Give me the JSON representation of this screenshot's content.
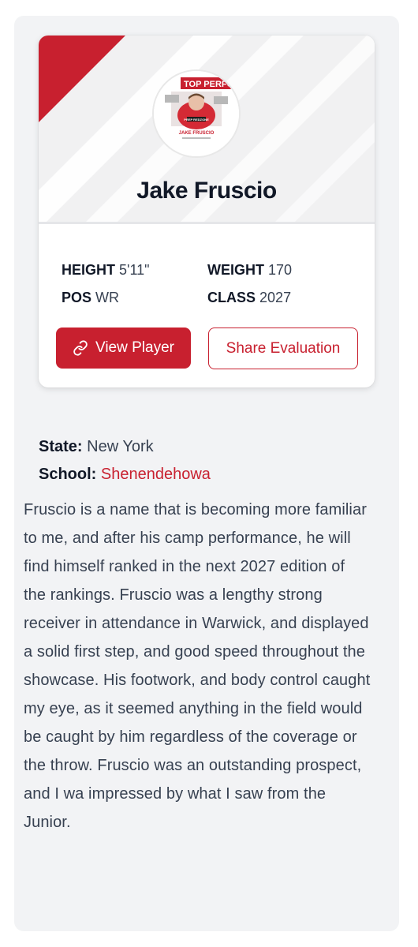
{
  "player": {
    "name": "Jake Fruscio",
    "photo_banner": "TOP PERFORMER",
    "photo_caption": "JAKE FRUSCIO",
    "photo_logo": "PREP REDZONE"
  },
  "stats": {
    "height_label": "HEIGHT",
    "height_value": "5'11\"",
    "weight_label": "WEIGHT",
    "weight_value": "170",
    "pos_label": "POS",
    "pos_value": "WR",
    "class_label": "CLASS",
    "class_value": "2027"
  },
  "actions": {
    "view_player": "View Player",
    "share_evaluation": "Share Evaluation"
  },
  "info": {
    "state_label": "State:",
    "state_value": "New York",
    "school_label": "School:",
    "school_value": "Shenendehowa"
  },
  "evaluation": {
    "text": "Fruscio is a name that is becoming more familiar to me, and after his camp performance, he will find himself ranked in the next 2027 edition of the rankings. Fruscio was a lengthy strong receiver in attendance in Warwick, and displayed a solid first step, and good speed throughout the showcase. His footwork, and body control caught my eye, as it seemed anything in the field would be caught by him regardless of the coverage or the throw. Fruscio was an outstanding prospect, and I wa impressed by what I saw from the Junior."
  },
  "colors": {
    "accent": "#c8202f",
    "panel_bg": "#f2f3f5",
    "text": "#374151"
  }
}
